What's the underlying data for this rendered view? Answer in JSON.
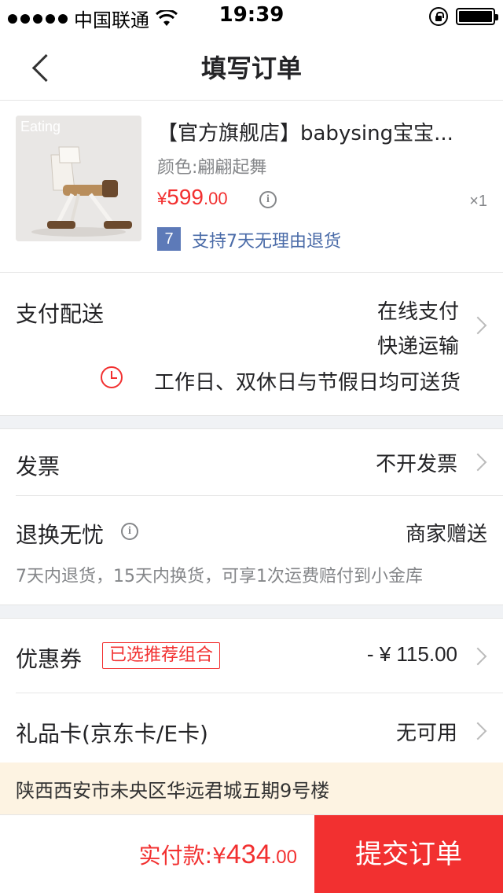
{
  "status_bar": {
    "carrier": "中国联通",
    "time": "19:39"
  },
  "nav": {
    "title": "填写订单"
  },
  "product": {
    "image_text": "Eating",
    "title": "【官方旗舰店】babysing宝宝...",
    "color_label": "颜色:翩翩起舞",
    "price_symbol": "¥",
    "price_int": "599",
    "price_dec": ".00",
    "quantity": "×1",
    "return_badge": "7",
    "return_text": "支持7天无理由退货"
  },
  "payment": {
    "label": "支付配送",
    "method": "在线支付",
    "shipping": "快递运输",
    "delivery_note": "工作日、双休日与节假日均可送货"
  },
  "invoice": {
    "label": "发票",
    "value": "不开发票"
  },
  "return_service": {
    "label": "退换无忧",
    "value": "商家赠送",
    "description": "7天内退货，15天内换货，可享1次运费赔付到小金库"
  },
  "coupon": {
    "label": "优惠券",
    "tag": "已选推荐组合",
    "value": "- ¥ 115.00"
  },
  "gift_card": {
    "label": "礼品卡(京东卡/E卡)",
    "value": "无可用"
  },
  "address": "陕西西安市未央区华远君城五期9号楼",
  "footer": {
    "total_label": "实付款:",
    "total_symbol": "¥",
    "total_int": "434",
    "total_dec": ".00",
    "submit_label": "提交订单"
  },
  "colors": {
    "accent": "#f23030",
    "link": "#4a6ba8",
    "address_bg": "#fdf3e2"
  }
}
